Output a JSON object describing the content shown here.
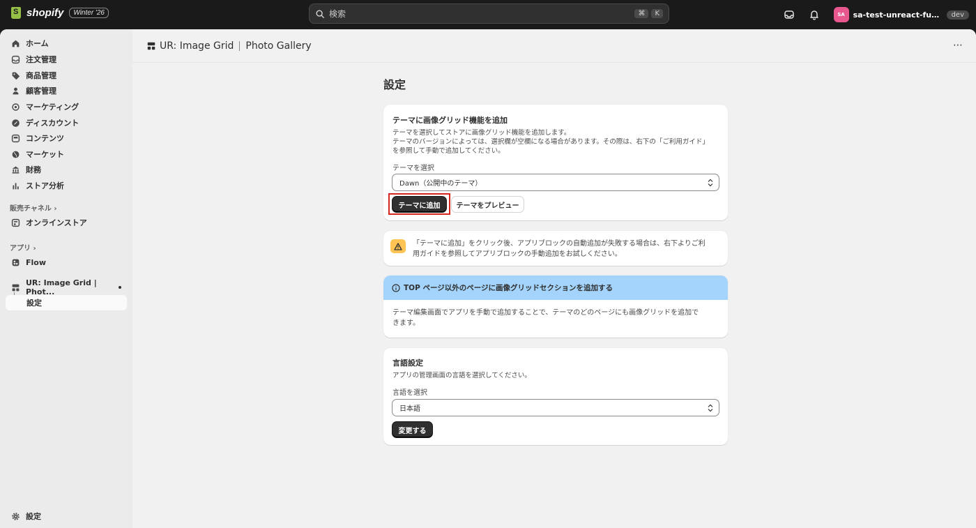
{
  "topbar": {
    "brand": "shopify",
    "edition_badge": "Winter '26",
    "search_placeholder": "検索",
    "search_kbd_1": "⌘",
    "search_kbd_2": "K",
    "store_avatar": "SA",
    "store_name": "sa-test-unreact-fukumot...",
    "store_badge": "dev"
  },
  "sidebar": {
    "items": [
      {
        "label": "ホーム",
        "icon": "home-icon"
      },
      {
        "label": "注文管理",
        "icon": "inbox-icon"
      },
      {
        "label": "商品管理",
        "icon": "tag-icon"
      },
      {
        "label": "顧客管理",
        "icon": "person-icon"
      },
      {
        "label": "マーケティング",
        "icon": "target-icon"
      },
      {
        "label": "ディスカウント",
        "icon": "discount-icon"
      },
      {
        "label": "コンテンツ",
        "icon": "content-icon"
      },
      {
        "label": "マーケット",
        "icon": "globe-icon"
      },
      {
        "label": "財務",
        "icon": "bank-icon"
      },
      {
        "label": "ストア分析",
        "icon": "chart-icon"
      }
    ],
    "sales_channels_label": "販売チャネル",
    "online_store_label": "オンラインストア",
    "apps_label": "アプリ",
    "flow_label": "Flow",
    "app_item_label": "UR: Image Grid | Phot...",
    "app_sub_label": "設定",
    "settings_label": "設定"
  },
  "header": {
    "app_name": "UR: Image Grid",
    "app_subtitle": "Photo Gallery",
    "more": "⋯"
  },
  "main": {
    "page_title": "設定",
    "theme_card": {
      "title": "テーマに画像グリッド機能を追加",
      "desc_1": "テーマを選択してストアに画像グリッド機能を追加します。",
      "desc_2": "テーマのバージョンによっては、選択欄が空欄になる場合があります。その際は、右下の「ご利用ガイド」",
      "desc_3": "を参照して手動で追加してください。",
      "select_label": "テーマを選択",
      "select_value": "Dawn（公開中のテーマ）",
      "add_button": "テーマに追加",
      "preview_button": "テーマをプレビュー"
    },
    "warning": {
      "line_1": "「テーマに追加」をクリック後、アプリブロックの自動追加が失敗する場合は、右下よりご利",
      "line_2": "用ガイドを参照してアプリブロックの手動追加をお試しください。"
    },
    "info_card": {
      "title": "TOP ページ以外のページに画像グリッドセクションを追加する",
      "line_1": "テーマ編集画面でアプリを手動で追加することで、テーマのどのページにも画像グリッドを追加で",
      "line_2": "きます。"
    },
    "language_card": {
      "title": "言語設定",
      "desc": "アプリの管理画面の言語を選択してください。",
      "select_label": "言語を選択",
      "select_value": "日本語",
      "change_button": "変更する"
    }
  },
  "colors": {
    "topbar": "#1a1a1a",
    "info_banner": "#a4d4fb",
    "warning": "#ffc453",
    "highlight": "#d7261e",
    "avatar": "#e8588f"
  }
}
